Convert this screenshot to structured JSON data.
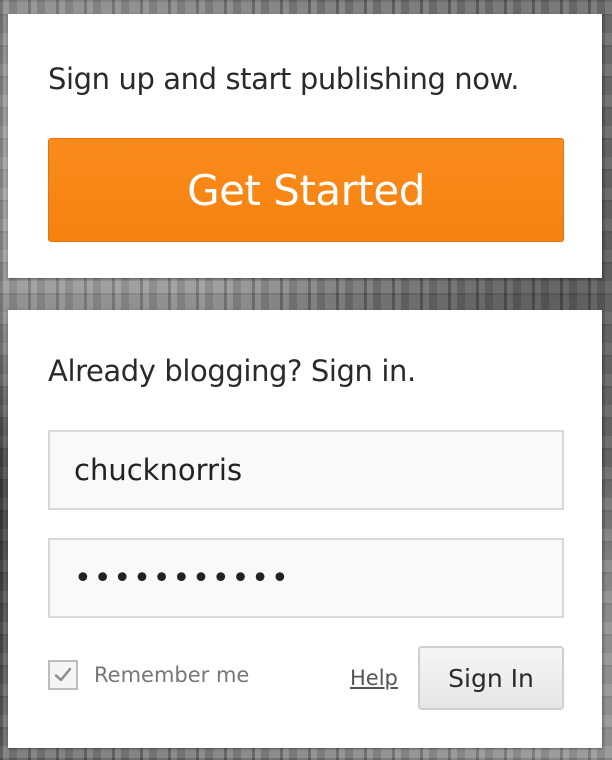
{
  "signup": {
    "prompt": "Sign up and start publishing now.",
    "button_label": "Get Started"
  },
  "signin": {
    "prompt": "Already blogging? Sign in.",
    "username_value": "chucknorris",
    "password_value": "•••••••••••",
    "remember_label": "Remember me",
    "remember_checked": true,
    "help_label": "Help",
    "button_label": "Sign In"
  },
  "colors": {
    "accent": "#f6820f",
    "panel_bg": "#ffffff"
  },
  "icons": {
    "remember_checkbox": "checkmark-icon"
  }
}
